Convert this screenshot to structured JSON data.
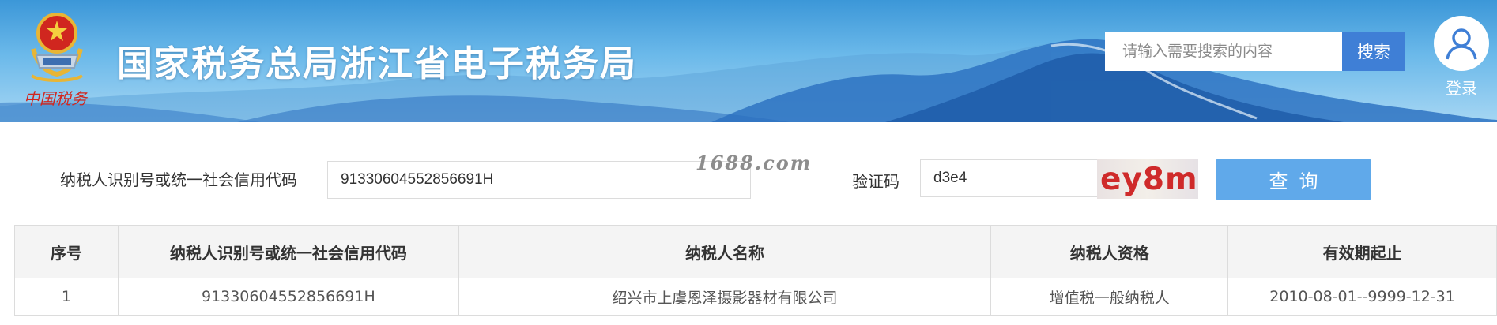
{
  "header": {
    "site_title": "国家税务总局浙江省电子税务局",
    "emblem_caption": "中国税务",
    "search": {
      "placeholder": "请输入需要搜索的内容",
      "button_label": "搜索"
    },
    "login_label": "登录",
    "colors": {
      "banner_top": "#3c97d8",
      "banner_bottom": "#a6d6f3",
      "search_button": "#3f7fd6"
    }
  },
  "query": {
    "taxpayer_id_label": "纳税人识别号或统一社会信用代码",
    "taxpayer_id_value": "91330604552856691H",
    "captcha_label": "验证码",
    "captcha_value": "d3e4",
    "captcha_image_text": "ey8m",
    "query_button_label": "查询",
    "watermark_text": "1688.com",
    "colors": {
      "query_button": "#60a9ea",
      "captcha_text": "#cf2a2a"
    }
  },
  "table": {
    "columns": [
      "序号",
      "纳税人识别号或统一社会信用代码",
      "纳税人名称",
      "纳税人资格",
      "有效期起止"
    ],
    "rows": [
      [
        "1",
        "91330604552856691H",
        "绍兴市上虞恩泽摄影器材有限公司",
        "增值税一般纳税人",
        "2010-08-01--9999-12-31"
      ]
    ]
  }
}
